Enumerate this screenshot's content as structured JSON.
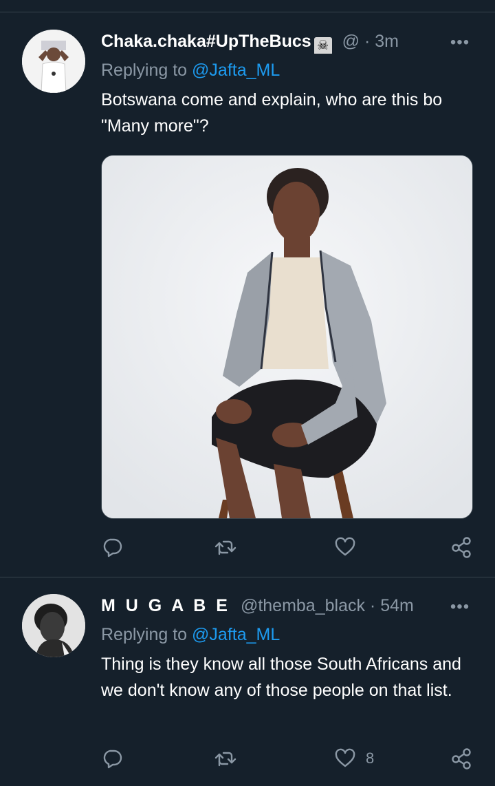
{
  "tweets": [
    {
      "display_name": "Chaka.chaka#UpTheBucs",
      "name_emoji": "☠",
      "handle": "@",
      "separator": "·",
      "time": "3m",
      "more_label": "•••",
      "replying_prefix": "Replying to ",
      "replying_handle": "@Jafta_ML",
      "text": "Botswana come and explain, who are this bo \"Many more\"?",
      "has_media": true,
      "like_count": ""
    },
    {
      "display_name": "M U G A B E",
      "handle": "@themba_black",
      "separator": "·",
      "time": "54m",
      "more_label": "•••",
      "replying_prefix": "Replying to ",
      "replying_handle": "@Jafta_ML",
      "text": "Thing is they know all those South Africans and we don't know any of those people on that list.",
      "has_media": false,
      "like_count": "8"
    }
  ],
  "icons": {
    "reply": "reply-icon",
    "retweet": "retweet-icon",
    "like": "heart-icon",
    "share": "share-icon",
    "more": "more-icon"
  },
  "colors": {
    "background": "#15202b",
    "divider": "#38444d",
    "text_primary": "#ffffff",
    "text_secondary": "#8b98a5",
    "link": "#1d9bf0"
  }
}
